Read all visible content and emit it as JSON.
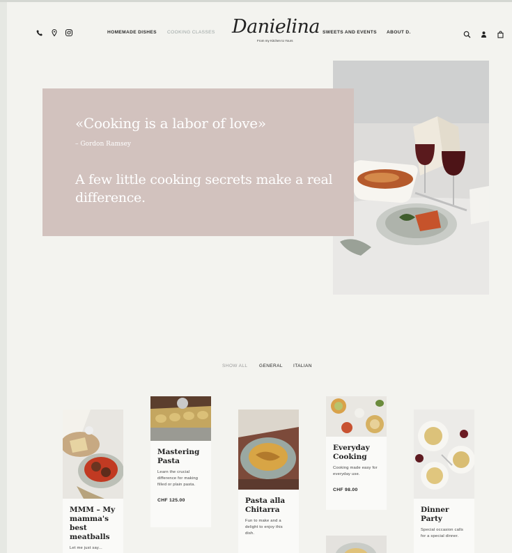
{
  "header": {
    "contact_icons": [
      "phone-icon",
      "location-pin-icon",
      "instagram-icon"
    ],
    "nav_left": [
      "HOMEMADE DISHES",
      "COOKING CLASSES"
    ],
    "nav_right": [
      "SWEETS AND EVENTS",
      "ABOUT D."
    ],
    "active_nav": "COOKING CLASSES",
    "logo": {
      "name": "Danielina",
      "tagline": "From my Kitchen to Yours"
    },
    "utility_icons": [
      "search-icon",
      "user-icon",
      "shopping-bag-icon"
    ]
  },
  "hero": {
    "quote": "«Cooking is a labor of love»",
    "author": "– Gordon Ramsey",
    "tagline": "A few little cooking secrets make a real difference.",
    "accent_color": "#d2c2be"
  },
  "filters": [
    "SHOW ALL",
    "GENERAL",
    "ITALIAN"
  ],
  "cards": [
    {
      "title": "MMM – My mamma's best meatballs",
      "desc": "Let me just say...",
      "price": ""
    },
    {
      "title": "Mastering Pasta",
      "desc": "Learn the crucial difference for making filled or plain pasta.",
      "price": "CHF 125.00"
    },
    {
      "title": "Pasta alla Chitarra",
      "desc": "Fun to make and a delight to enjoy this dish.",
      "price": ""
    },
    {
      "title": "Everyday Cooking",
      "desc": "Cooking made easy for everyday use.",
      "price": "CHF 98.00"
    },
    {
      "title": "Dinner Party",
      "desc": "Special occasion calls for a special dinner.",
      "price": ""
    }
  ]
}
